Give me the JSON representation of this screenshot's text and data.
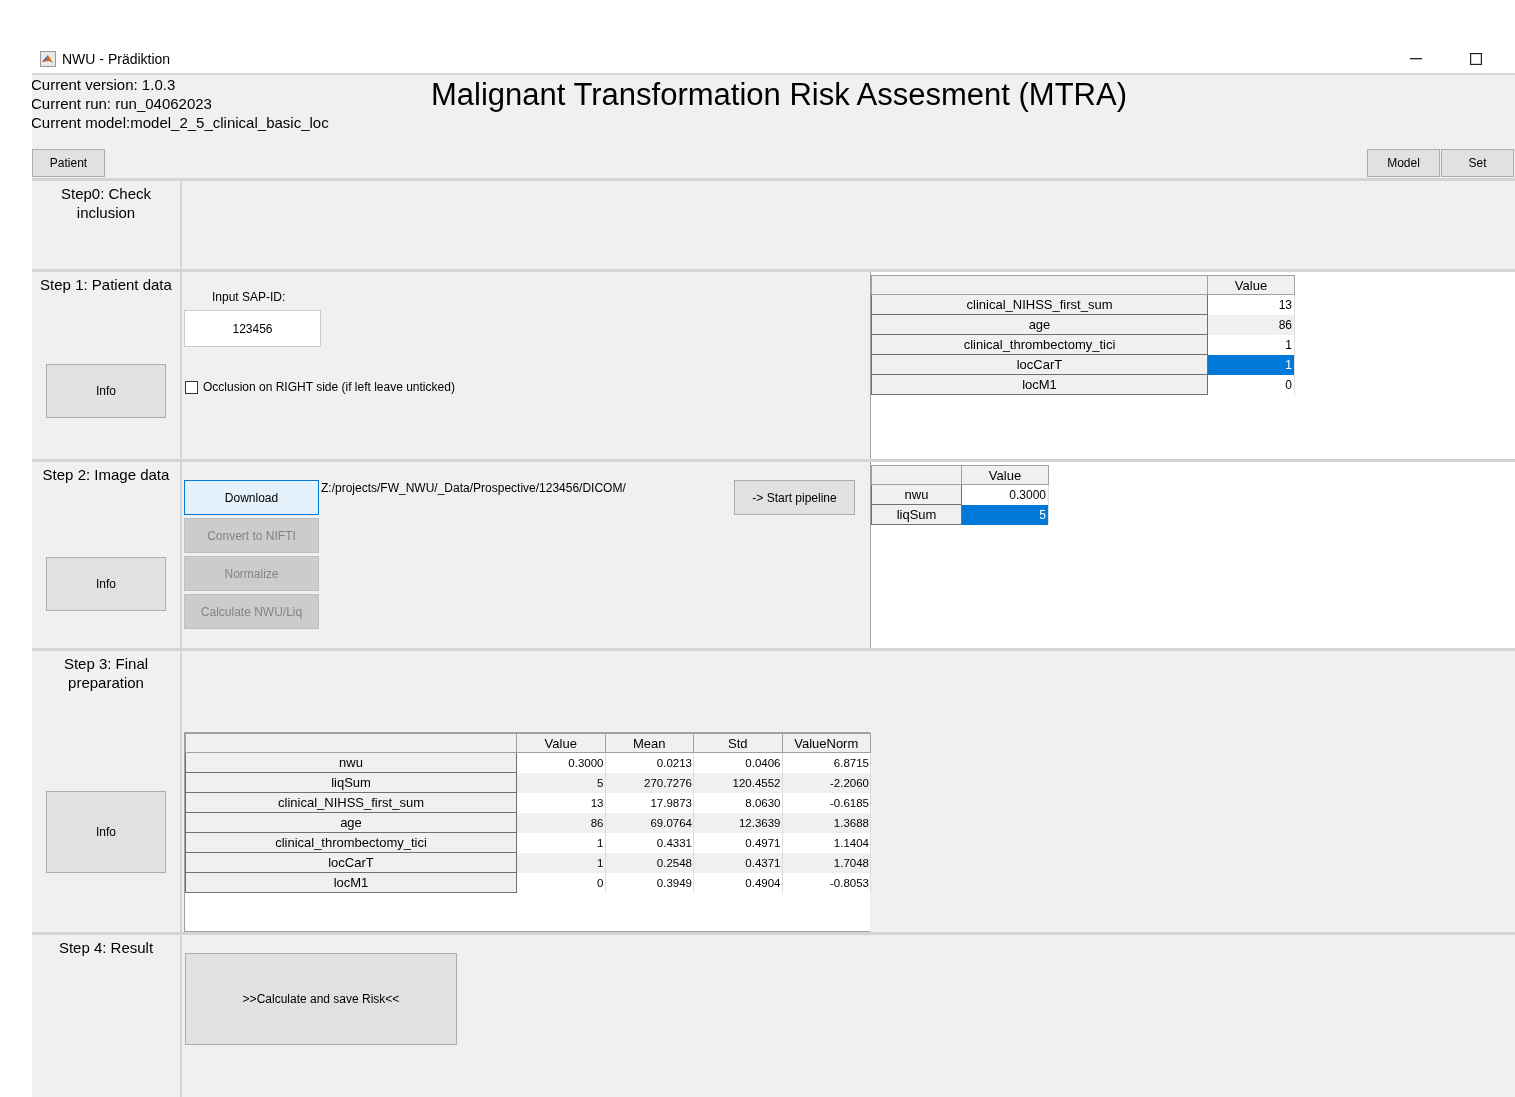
{
  "window": {
    "title": "NWU - Prädiktion"
  },
  "header": {
    "info_lines": [
      "Current version: 1.0.3",
      "Current run: run_04062023",
      "Current model:model_2_5_clinical_basic_loc"
    ],
    "title": "Malignant Transformation Risk Assesment (MTRA)"
  },
  "left_tabs": [
    {
      "label": "Patient",
      "selected": false
    }
  ],
  "right_tabs": [
    {
      "label": "Model",
      "selected": false
    },
    {
      "label": "Set",
      "selected": false
    }
  ],
  "steps": [
    {
      "kind": "check",
      "label": "Step0: Check inclusion"
    },
    {
      "kind": "patient",
      "label": "Step 1: Patient data",
      "info_button": "Info",
      "sap_label": "Input SAP-ID:",
      "sap_value": "123456",
      "checkbox": {
        "label": "Occlusion on RIGHT side (if left leave unticked)",
        "checked": false
      },
      "table": {
        "columns": [
          "Value"
        ],
        "rows": [
          {
            "name": "clinical_NIHSS_first_sum",
            "value": "13",
            "selected": false
          },
          {
            "name": "age",
            "value": "86",
            "selected": false
          },
          {
            "name": "clinical_thrombectomy_tici",
            "value": "1",
            "selected": false
          },
          {
            "name": "locCarT",
            "value": "1",
            "selected": true
          },
          {
            "name": "locM1",
            "value": "0",
            "selected": false
          }
        ]
      }
    },
    {
      "kind": "image",
      "label": "Step 2: Image data",
      "info_button": "Info",
      "buttons": [
        {
          "label": "Download",
          "disabled": false,
          "focused": true
        },
        {
          "label": "Convert to NIFTI",
          "disabled": true,
          "focused": false
        },
        {
          "label": "Normalize",
          "disabled": true,
          "focused": false
        },
        {
          "label": "Calculate NWU/Liq",
          "disabled": true,
          "focused": false
        }
      ],
      "path": "Z:/projects/FW_NWU/_Data/Prospective/123456/DICOM/",
      "pipeline_button": "-> Start pipeline",
      "table": {
        "columns": [
          "Value"
        ],
        "rows": [
          {
            "name": "nwu",
            "value": "0.3000",
            "selected": false
          },
          {
            "name": "liqSum",
            "value": "5",
            "selected": true
          }
        ]
      }
    },
    {
      "kind": "final",
      "label": "Step 3: Final preparation",
      "info_button": "Info",
      "table": {
        "columns": [
          "Value",
          "Mean",
          "Std",
          "ValueNorm"
        ],
        "rows": [
          {
            "name": "nwu",
            "cells": [
              "0.3000",
              "0.0213",
              "0.0406",
              "6.8715"
            ]
          },
          {
            "name": "liqSum",
            "cells": [
              "5",
              "270.7276",
              "120.4552",
              "-2.2060"
            ]
          },
          {
            "name": "clinical_NIHSS_first_sum",
            "cells": [
              "13",
              "17.9873",
              "8.0630",
              "-0.6185"
            ]
          },
          {
            "name": "age",
            "cells": [
              "86",
              "69.0764",
              "12.3639",
              "1.3688"
            ]
          },
          {
            "name": "clinical_thrombectomy_tici",
            "cells": [
              "1",
              "0.4331",
              "0.4971",
              "1.1404"
            ]
          },
          {
            "name": "locCarT",
            "cells": [
              "1",
              "0.2548",
              "0.4371",
              "1.7048"
            ]
          },
          {
            "name": "locM1",
            "cells": [
              "0",
              "0.3949",
              "0.4904",
              "-0.8053"
            ]
          }
        ]
      }
    },
    {
      "kind": "result",
      "label": "Step 4: Result",
      "result_button": ">>Calculate and save Risk<<"
    }
  ]
}
